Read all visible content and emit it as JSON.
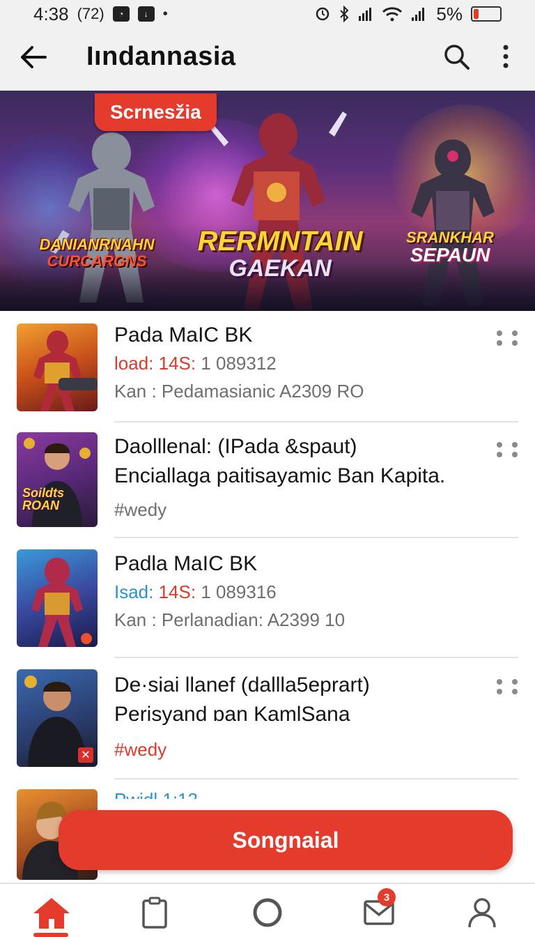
{
  "status_bar": {
    "time": "4:38",
    "notif_count": "(72)",
    "battery_percent": "5%",
    "battery_level": 0.05,
    "battery_color": "#e53b2c"
  },
  "app_bar": {
    "title": "Iındannasia",
    "back_icon": "arrow-left-icon",
    "search_icon": "search-icon",
    "more_icon": "more-vertical-icon"
  },
  "banner": {
    "pill_label": "Scrnesžia",
    "left_text_1": "DANIANRNAHN",
    "left_text_2": "CURCARGNS",
    "center_text_1": "RERMNTAIN",
    "center_text_2": "GAEKAN",
    "right_text_1": "SRANKHAR",
    "right_text_2": "SEPAUN"
  },
  "items": [
    {
      "title": "Pada MaIC BK",
      "line1_prefix": "load: 14S:",
      "line1_value": " 1 089312",
      "line2": "Kan : Pedamasianic A2309 RO"
    },
    {
      "title": "Daolllenal: (IPada &spaut)",
      "line2": "Enciallaga paitisayamic Ban Kapita.",
      "tag": "#wedy",
      "thumb_text_1": "Soildts",
      "thumb_text_2": "ROAN"
    },
    {
      "title": "Padla MaIC BK",
      "line1_prefix_a": "Isad:",
      "line1_prefix_b": " 14S:",
      "line1_value": " 1 089316",
      "line2": "Kan : Perlanadian: A2399 10"
    },
    {
      "title": "De·siai llanef (dallla5eprart)",
      "line2": "Perisyand ɒan KamlSana",
      "tag": "#wedy",
      "badge": "✕"
    },
    {
      "title_partial": "Pwidl    1:12"
    }
  ],
  "cta": {
    "label": "Songnaial"
  },
  "bottom_nav": {
    "items": [
      "home-icon",
      "clipboard-icon",
      "circle-icon",
      "mail-icon",
      "profile-icon"
    ],
    "mail_badge": "3"
  },
  "colors": {
    "accent": "#e53b2c",
    "blue_text": "#2a92d0"
  }
}
